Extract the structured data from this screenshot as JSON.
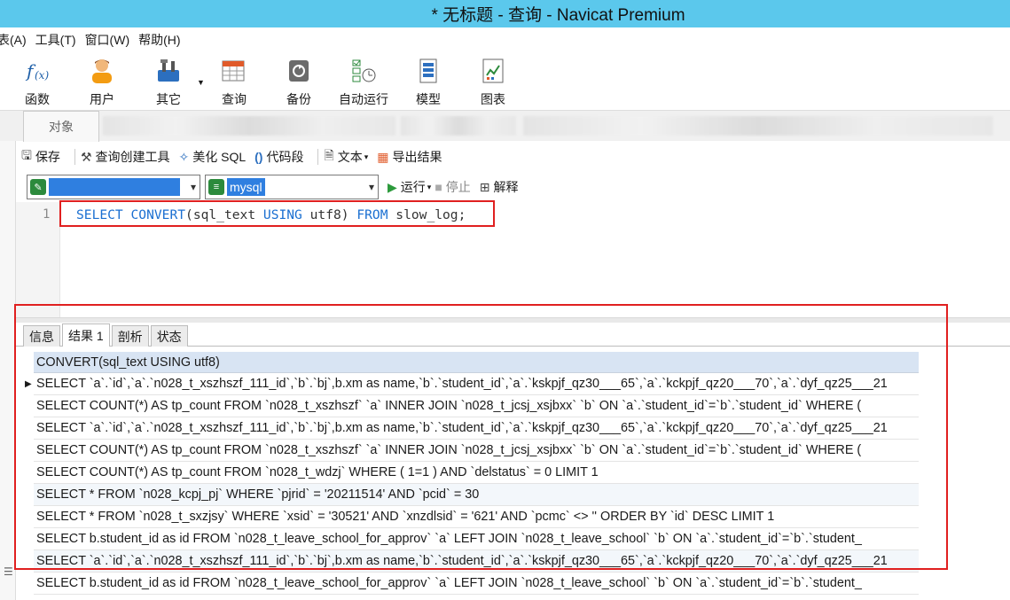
{
  "window": {
    "title": "* 无标题 - 查询 - Navicat Premium"
  },
  "menu": [
    "表(A)",
    "工具(T)",
    "窗口(W)",
    "帮助(H)"
  ],
  "toolbar": {
    "items": [
      {
        "label": "函数",
        "icon": "function-icon"
      },
      {
        "label": "用户",
        "icon": "user-icon"
      },
      {
        "label": "其它",
        "icon": "tools-icon"
      },
      {
        "label": "查询",
        "icon": "query-icon"
      },
      {
        "label": "备份",
        "icon": "backup-icon"
      },
      {
        "label": "自动运行",
        "icon": "autorun-icon"
      },
      {
        "label": "模型",
        "icon": "model-icon"
      },
      {
        "label": "图表",
        "icon": "chart-icon"
      }
    ]
  },
  "tabs": {
    "objects": "对象"
  },
  "query_toolbar": {
    "save": "保存",
    "query_builder": "查询创建工具",
    "beautify": "美化 SQL",
    "snippet": "代码段",
    "text": "文本",
    "export": "导出结果"
  },
  "selectors": {
    "connection": "",
    "database": "mysql",
    "run": "运行",
    "stop": "停止",
    "explain": "解释"
  },
  "editor": {
    "line_number": "1",
    "sql_keywords": [
      "SELECT",
      "CONVERT",
      "USING",
      "FROM"
    ],
    "sql_parts": {
      "p1": "SELECT",
      "p2": "CONVERT",
      "p3": "(sql_text ",
      "p4": "USING",
      "p5": " utf8) ",
      "p6": "FROM",
      "p7": " slow_log;"
    }
  },
  "result_tabs": [
    "信息",
    "结果 1",
    "剖析",
    "状态"
  ],
  "grid": {
    "header": "CONVERT(sql_text USING utf8)",
    "rows": [
      "SELECT `a`.`id`,`a`.`n028_t_xszhszf_111_id`,`b`.`bj`,b.xm as name,`b`.`student_id`,`a`.`kskpjf_qz30___65`,`a`.`kckpjf_qz20___70`,`a`.`dyf_qz25___21",
      "SELECT COUNT(*) AS tp_count FROM `n028_t_xszhszf` `a` INNER JOIN `n028_t_jcsj_xsjbxx` `b` ON `a`.`student_id`=`b`.`student_id` WHERE  (",
      "SELECT `a`.`id`,`a`.`n028_t_xszhszf_111_id`,`b`.`bj`,b.xm as name,`b`.`student_id`,`a`.`kskpjf_qz30___65`,`a`.`kckpjf_qz20___70`,`a`.`dyf_qz25___21",
      "SELECT COUNT(*) AS tp_count FROM `n028_t_xszhszf` `a` INNER JOIN `n028_t_jcsj_xsjbxx` `b` ON `a`.`student_id`=`b`.`student_id` WHERE  (",
      "SELECT COUNT(*) AS tp_count FROM `n028_t_wdzj` WHERE  (  1=1  )  AND `delstatus` = 0 LIMIT 1",
      "SELECT * FROM `n028_kcpj_pj` WHERE  `pjrid` = '20211514'  AND `pcid` = 30",
      "SELECT * FROM `n028_t_sxzjsy` WHERE  `xsid` = '30521'  AND `xnzdlsid` = '621'  AND `pcmc` <> '' ORDER BY `id` DESC LIMIT 1",
      "SELECT b.student_id as id FROM `n028_t_leave_school_for_approv` `a` LEFT JOIN `n028_t_leave_school` `b` ON `a`.`student_id`=`b`.`student_",
      "SELECT `a`.`id`,`a`.`n028_t_xszhszf_111_id`,`b`.`bj`,b.xm as name,`b`.`student_id`,`a`.`kskpjf_qz30___65`,`a`.`kckpjf_qz20___70`,`a`.`dyf_qz25___21",
      "SELECT b.student_id as id FROM `n028_t_leave_school_for_approv` `a` LEFT JOIN `n028_t_leave_school` `b` ON `a`.`student_id`=`b`.`student_"
    ]
  },
  "colors": {
    "accent_title": "#5bc8ec",
    "highlight_box": "#e02020",
    "selection": "#2f7fe0"
  }
}
